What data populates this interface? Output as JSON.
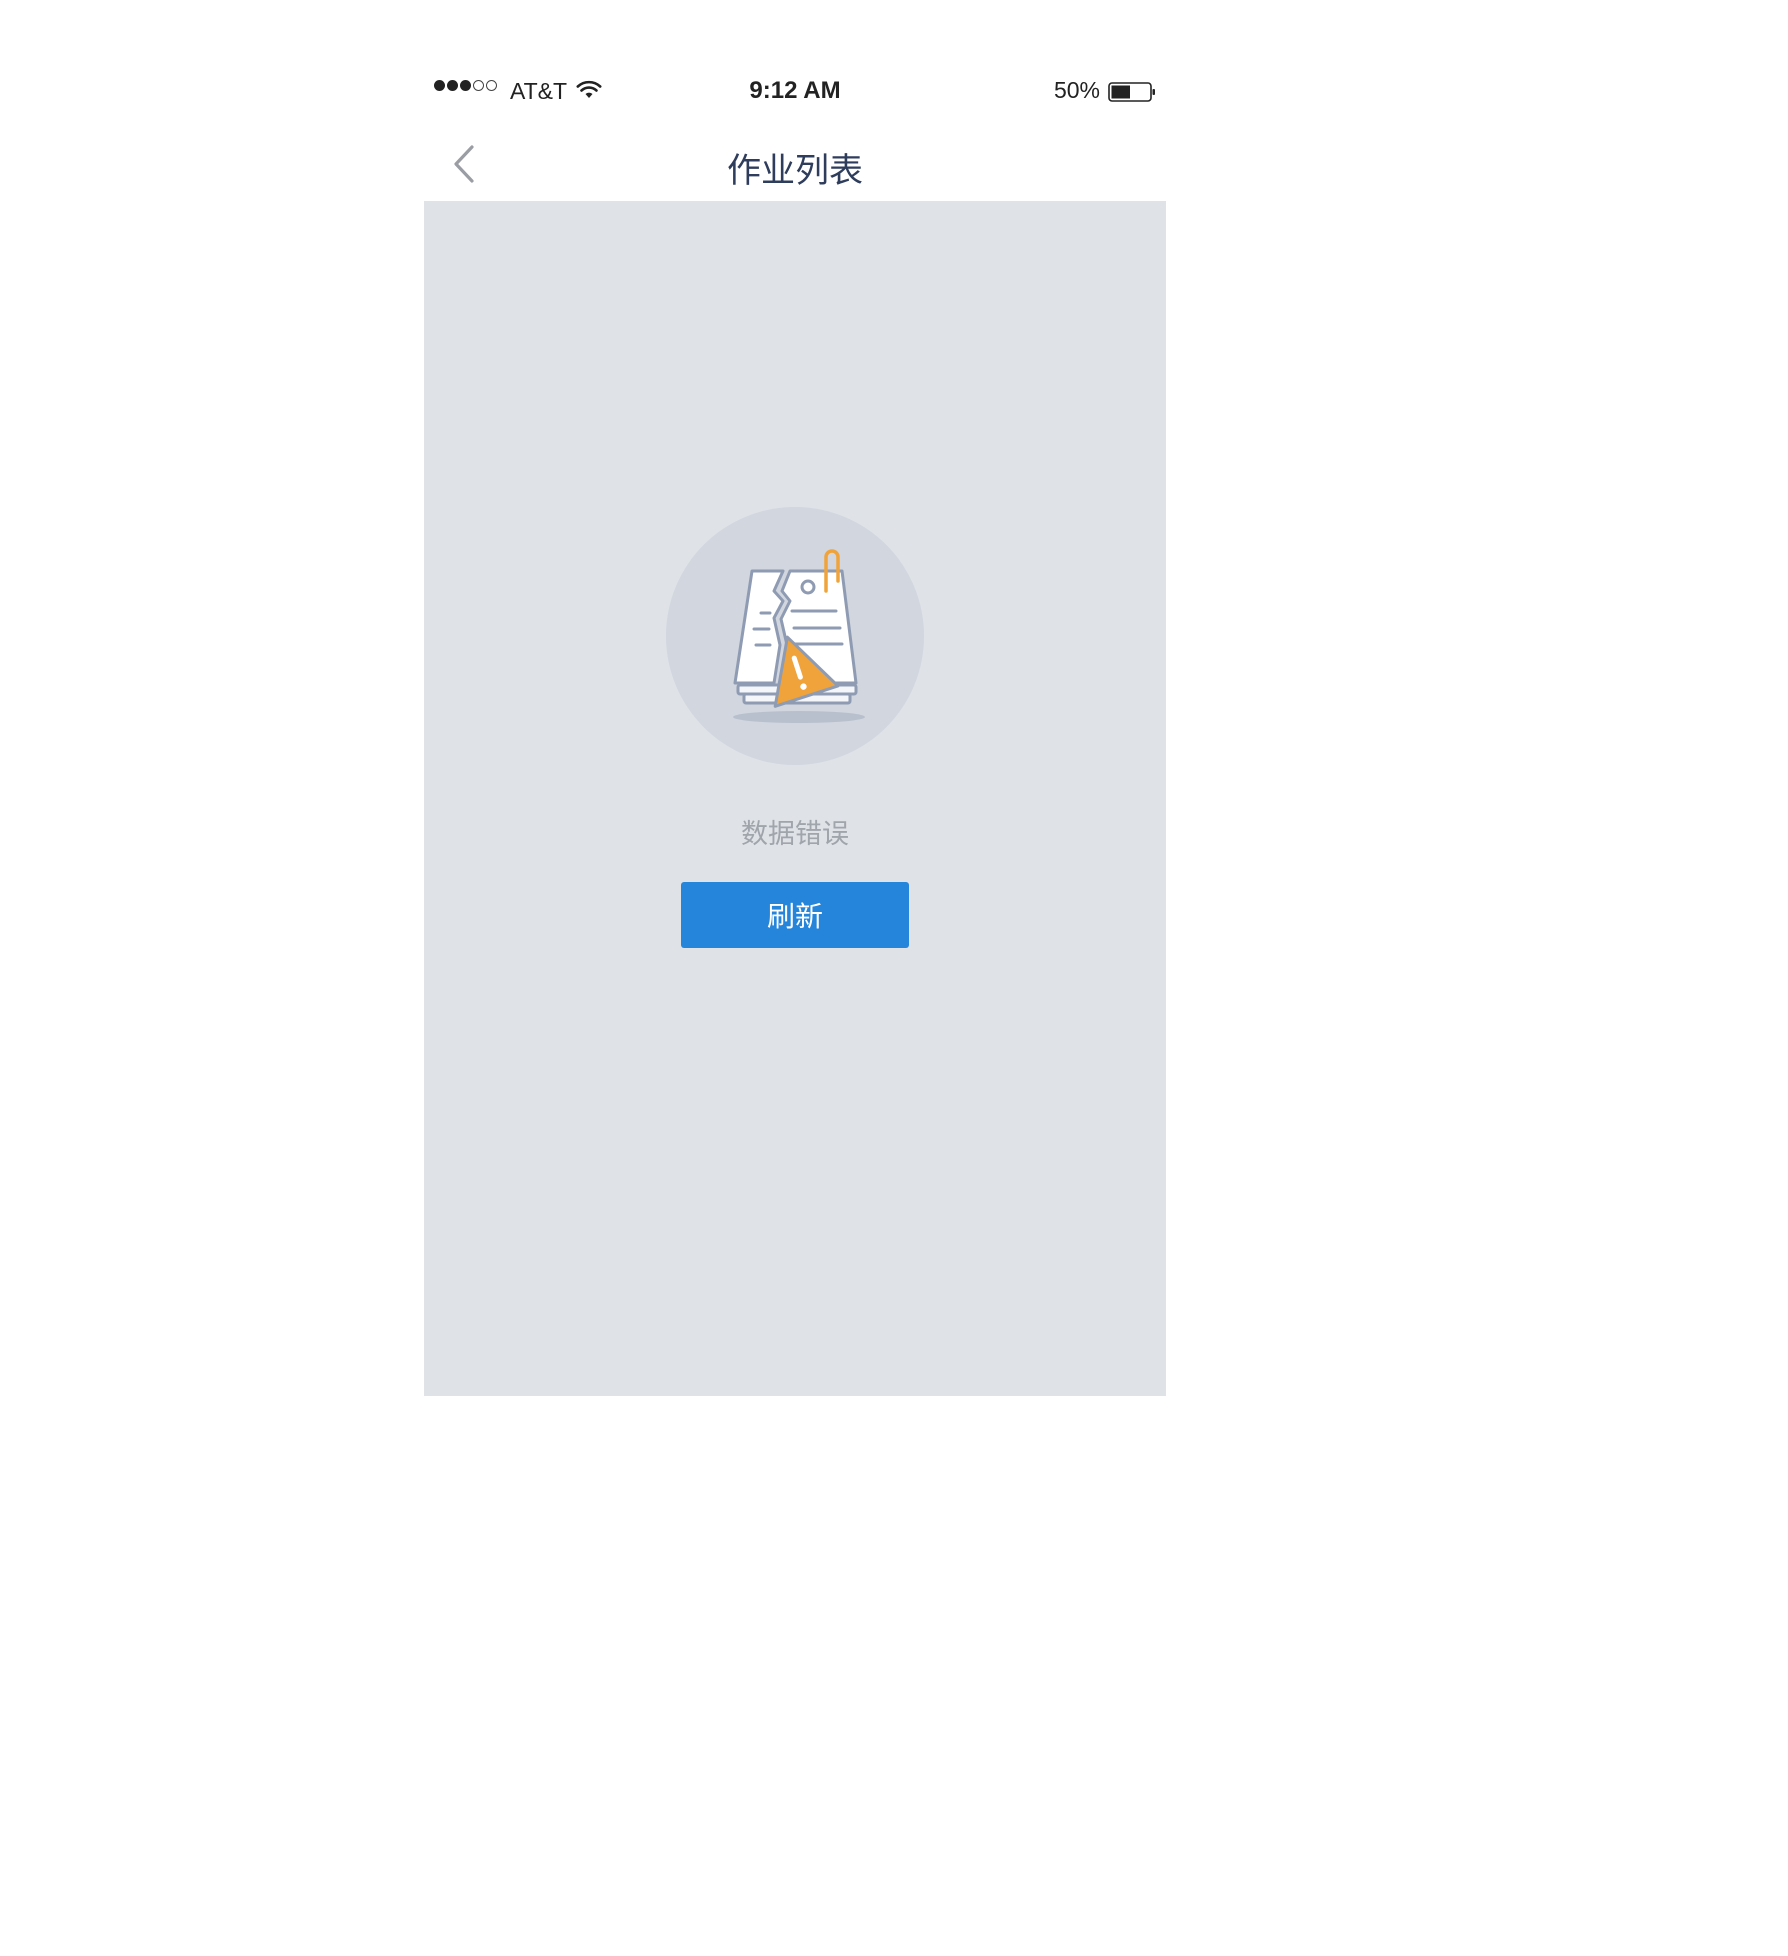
{
  "status_bar": {
    "signal_bars": 3,
    "signal_total": 5,
    "carrier": "AT&T",
    "time": "9:12 AM",
    "battery_percent": "50%",
    "battery_level": 0.5
  },
  "nav": {
    "back_icon": "chevron-left-icon",
    "title": "作业列表"
  },
  "error_state": {
    "illustration_icon": "broken-document-warning-icon",
    "message": "数据错误",
    "refresh_label": "刷新"
  },
  "colors": {
    "content_background": "#dfe2e7",
    "button_background": "#2585db",
    "title_color": "#2f3d5c",
    "message_color": "#a0a4ab",
    "warning_color": "#f0a33a"
  }
}
